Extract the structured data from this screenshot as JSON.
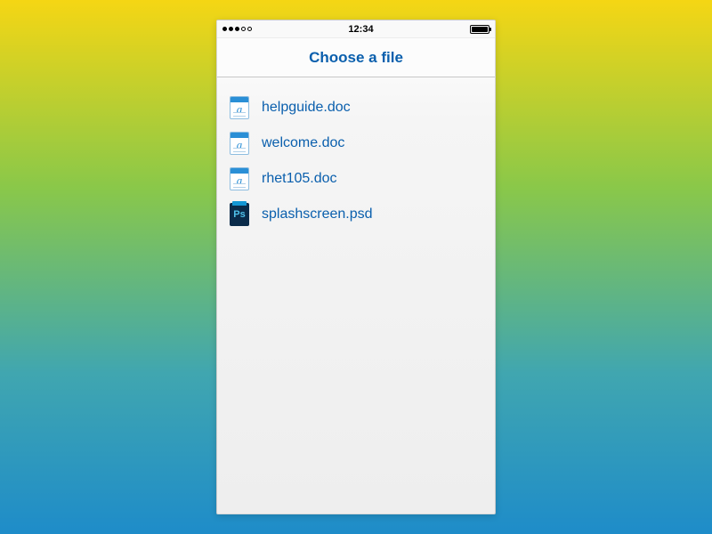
{
  "status": {
    "time": "12:34"
  },
  "header": {
    "title": "Choose a file"
  },
  "files": [
    {
      "name": "helpguide.doc",
      "type": "doc"
    },
    {
      "name": "welcome.doc",
      "type": "doc"
    },
    {
      "name": "rhet105.doc",
      "type": "doc"
    },
    {
      "name": "splashscreen.psd",
      "type": "psd"
    }
  ]
}
